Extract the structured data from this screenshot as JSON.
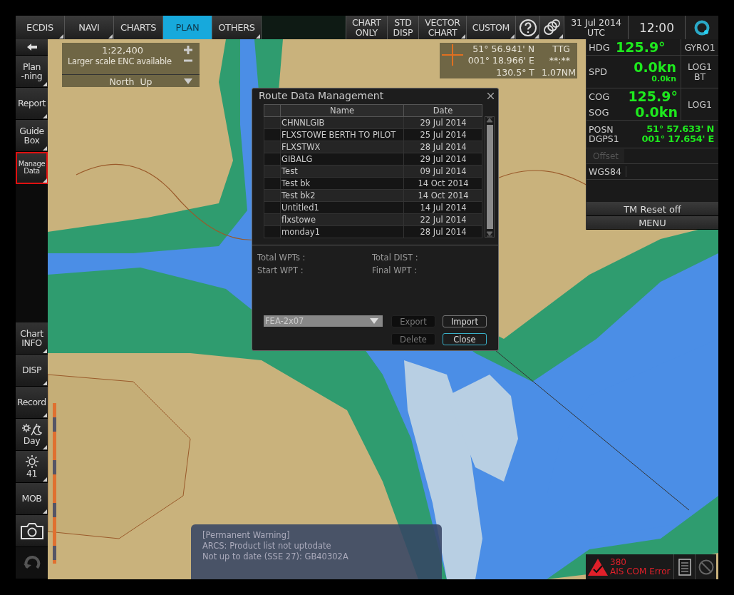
{
  "top_menu": [
    {
      "label": "ECDIS",
      "selected": false,
      "submenu": true
    },
    {
      "label": "NAVI",
      "selected": false,
      "submenu": true
    },
    {
      "label": "CHARTS",
      "selected": false,
      "submenu": false
    },
    {
      "label": "PLAN",
      "selected": true,
      "submenu": false
    },
    {
      "label": "OTHERS",
      "selected": false,
      "submenu": true
    }
  ],
  "display_buttons": [
    {
      "lines": [
        "CHART",
        "ONLY"
      ],
      "submenu": false
    },
    {
      "lines": [
        "STD",
        "DISP"
      ],
      "submenu": false
    },
    {
      "lines": [
        "VECTOR",
        "CHART"
      ],
      "submenu": true
    },
    {
      "lines": [
        "CUSTOM"
      ],
      "submenu": true
    }
  ],
  "date_lines": [
    "31 Jul 2014",
    "UTC"
  ],
  "time": "12:00",
  "sidebar_top": [
    {
      "kind": "back"
    },
    {
      "kind": "text",
      "lines": [
        "Plan",
        "-ning"
      ],
      "highlighted": false
    },
    {
      "kind": "text",
      "lines": [
        "Report"
      ],
      "highlighted": false
    },
    {
      "kind": "text",
      "lines": [
        "Guide",
        "Box"
      ],
      "highlighted": false
    },
    {
      "kind": "text",
      "lines": [
        "Manage",
        "Data"
      ],
      "highlighted": true
    }
  ],
  "sidebar_bottom": [
    {
      "kind": "text",
      "lines": [
        "Chart",
        "INFO"
      ]
    },
    {
      "kind": "text",
      "lines": [
        "DISP"
      ]
    },
    {
      "kind": "text",
      "lines": [
        "Record"
      ]
    },
    {
      "kind": "daynight",
      "label": "Day"
    },
    {
      "kind": "brightness",
      "label": "41"
    },
    {
      "kind": "text",
      "lines": [
        "MOB"
      ]
    },
    {
      "kind": "camera"
    },
    {
      "kind": "undo"
    }
  ],
  "scale_box": {
    "scale": "1:22,400",
    "note": "Larger scale ENC available",
    "orientation": "North  Up"
  },
  "cursor_box": {
    "lat": "51° 56.941' N",
    "lon": "001° 18.966' E",
    "bearing": "130.5° T",
    "ttg_label": "TTG",
    "ttg": "**:**",
    "distance": "1.07NM"
  },
  "nav_panel": {
    "hdg": {
      "label": "HDG",
      "value": "125.9°",
      "source": "GYRO1"
    },
    "spd": {
      "label": "SPD",
      "value": "0.0kn",
      "sub_value": "0.0kn",
      "source_lines": [
        "LOG1",
        "BT"
      ]
    },
    "cog": {
      "label": "COG",
      "value": "125.9°"
    },
    "sog": {
      "label": "SOG",
      "value": "0.0kn"
    },
    "cog_sog_source": "LOG1",
    "position": {
      "labels": [
        "POSN",
        "DGPS1"
      ],
      "lat": "51° 57.633' N",
      "lon": "001° 17.654' E"
    },
    "offset": {
      "label": "Offset",
      "disabled": true
    },
    "datum": "WGS84",
    "tm_reset": "TM Reset off",
    "menu": "MENU"
  },
  "dialog": {
    "title": "Route Data Management",
    "columns": [
      "Name",
      "Date"
    ],
    "rows": [
      {
        "name": "CHNNLGIB",
        "date": "29 Jul 2014"
      },
      {
        "name": "FLXSTOWE BERTH TO PILOT",
        "date": "25 Jul 2014"
      },
      {
        "name": "FLXSTWX",
        "date": "28 Jul 2014"
      },
      {
        "name": "GIBALG",
        "date": "29 Jul 2014"
      },
      {
        "name": "Test",
        "date": "09 Jul 2014"
      },
      {
        "name": "Test bk",
        "date": "14 Oct 2014"
      },
      {
        "name": "Test bk2",
        "date": "14 Oct 2014"
      },
      {
        "name": "Untitled1",
        "date": "14 Jul 2014"
      },
      {
        "name": "flxstowe",
        "date": "22 Jul 2014"
      },
      {
        "name": "monday1",
        "date": "28 Jul 2014"
      }
    ],
    "summary": [
      {
        "label": "Total WPTs :"
      },
      {
        "label": "Total DIST :"
      },
      {
        "label": "Start WPT :"
      },
      {
        "label": "Final WPT :"
      }
    ],
    "device": "FEA-2x07",
    "buttons": [
      {
        "label": "Export",
        "disabled": true,
        "focused": false
      },
      {
        "label": "Import",
        "disabled": false,
        "focused": false
      },
      {
        "label": "Delete",
        "disabled": true,
        "focused": false
      },
      {
        "label": "Close",
        "disabled": false,
        "focused": true
      }
    ]
  },
  "warning": [
    "[Permanent Warning]",
    "ARCS: Product list not uptodate",
    "Not up to date (SSE 27): GB40302A"
  ],
  "alert": {
    "code": "380",
    "message": "AIS COM Error"
  }
}
